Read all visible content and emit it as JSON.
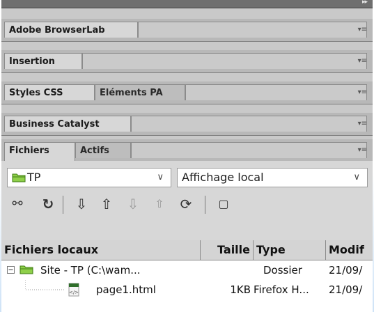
{
  "panels": {
    "browserlab": {
      "tab": "Adobe BrowserLab"
    },
    "insertion": {
      "tab": "Insertion"
    },
    "styles": {
      "tabs": [
        "Styles CSS",
        "Eléments PA"
      ]
    },
    "business": {
      "tab": "Business Catalyst"
    },
    "files": {
      "tabs": [
        "Fichiers",
        "Actifs"
      ]
    }
  },
  "files_panel": {
    "site_select": "TP",
    "view_select": "Affichage local",
    "columns": [
      "Fichiers locaux",
      "Taille",
      "Type",
      "Modif"
    ],
    "rows": [
      {
        "name": "Site - TP (C:\\wam...",
        "size": "",
        "type": "Dossier",
        "modified": "21/09/"
      },
      {
        "name": "page1.html",
        "size": "1KB",
        "type": "Firefox H...",
        "modified": "21/09/"
      }
    ]
  },
  "colors": {
    "folder": "#7ec43a",
    "panel": "#d7d7d7",
    "header_strip": "#6f6f6f"
  }
}
